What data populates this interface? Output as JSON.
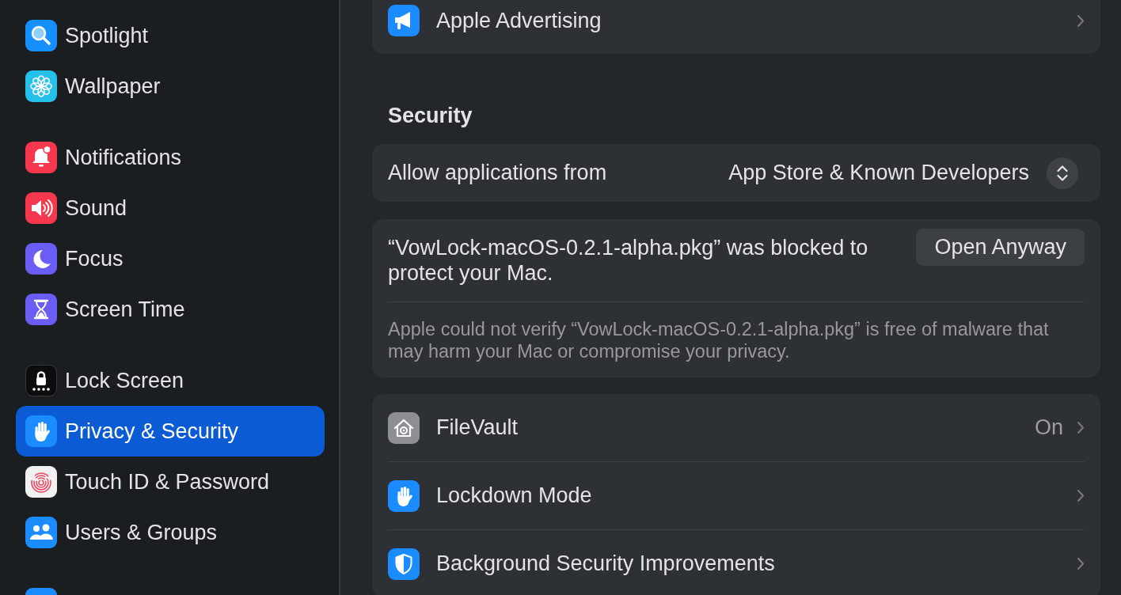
{
  "sidebar": {
    "groups": [
      {
        "items": [
          {
            "label": "Spotlight",
            "selected": false
          },
          {
            "label": "Wallpaper",
            "selected": false
          }
        ]
      },
      {
        "items": [
          {
            "label": "Notifications",
            "selected": false
          },
          {
            "label": "Sound",
            "selected": false
          },
          {
            "label": "Focus",
            "selected": false
          },
          {
            "label": "Screen Time",
            "selected": false
          }
        ]
      },
      {
        "items": [
          {
            "label": "Lock Screen",
            "selected": false
          },
          {
            "label": "Privacy & Security",
            "selected": true
          },
          {
            "label": "Touch ID & Password",
            "selected": false
          },
          {
            "label": "Users & Groups",
            "selected": false
          }
        ]
      }
    ]
  },
  "main": {
    "privacy_card": {
      "rows": [
        {
          "label": "Apple Advertising"
        }
      ]
    },
    "security": {
      "heading": "Security",
      "allow_row": {
        "label": "Allow applications from",
        "value": "App Store & Known Developers"
      },
      "blocked_notice": {
        "message": "“VowLock-macOS-0.2.1-alpha.pkg” was blocked to protect your Mac.",
        "button": "Open Anyway",
        "note": "Apple could not verify “VowLock-macOS-0.2.1-alpha.pkg” is free of malware that may harm your Mac or compromise your privacy."
      },
      "settings": [
        {
          "label": "FileVault",
          "value": "On"
        },
        {
          "label": "Lockdown Mode"
        },
        {
          "label": "Background Security Improvements"
        }
      ]
    }
  }
}
